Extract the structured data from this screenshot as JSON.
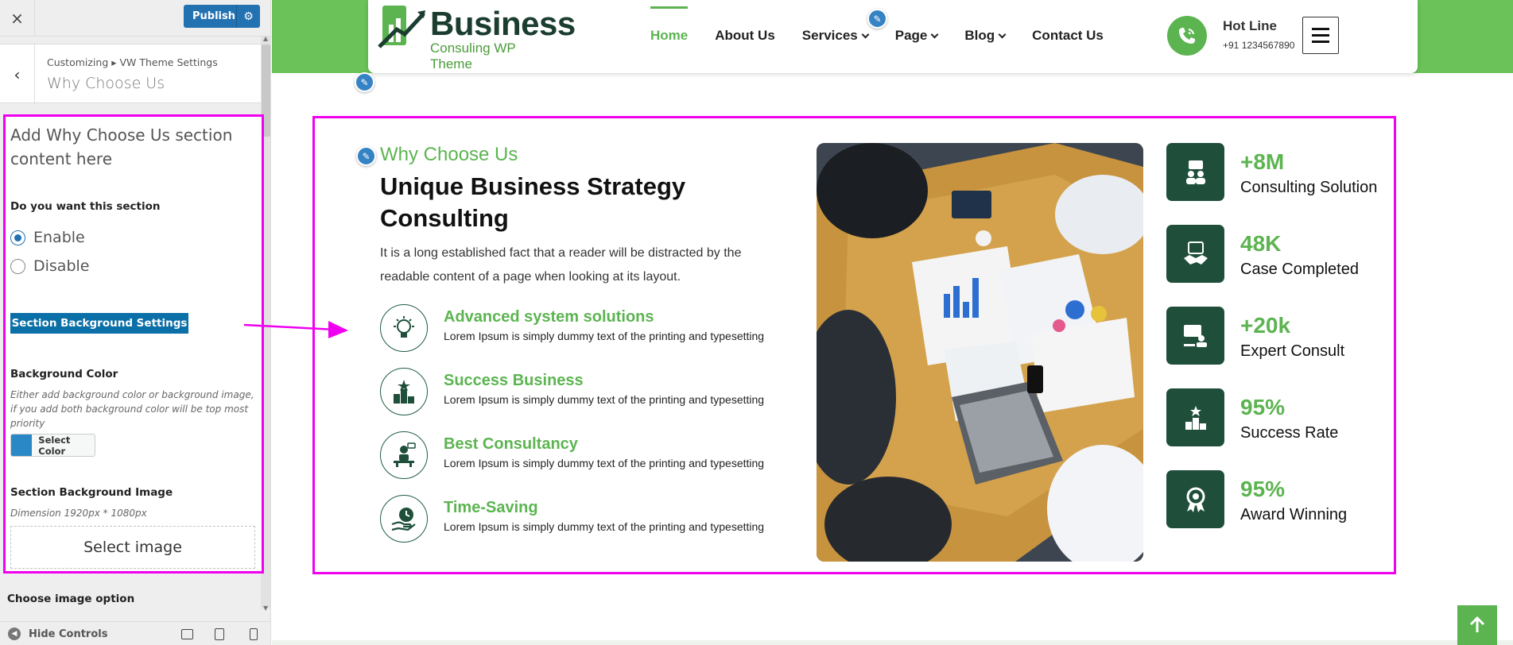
{
  "customizer": {
    "close_glyph": "×",
    "publish_label": "Publish",
    "breadcrumb": "Customizing ▸ VW Theme Settings",
    "section_title": "Why Choose Us",
    "panel": {
      "intro": "Add Why Choose Us section content here",
      "question": "Do you want this section",
      "options": [
        "Enable",
        "Disable"
      ],
      "selected": "Enable",
      "bg_settings_label": "Section Background Settings",
      "bg_color_label": "Background Color",
      "bg_color_note": "Either add background color or background image, if you add both background color will be top most priority",
      "select_color_label": "Select Color",
      "swatch_color": "#2b88c6",
      "bg_image_label": "Section Background Image",
      "dimension_note": "Dimension 1920px * 1080px",
      "select_image_label": "Select image"
    },
    "next_label": "Choose image option",
    "hide_controls_label": "Hide Controls",
    "devices": [
      "desktop-icon",
      "tablet-icon",
      "mobile-icon"
    ]
  },
  "site": {
    "accent": "#5cb451",
    "dark_green": "#1f4f3b",
    "logo": {
      "title": "Business",
      "subtitle": "Consuling WP Theme"
    },
    "nav": [
      {
        "label": "Home",
        "active": true,
        "dropdown": false
      },
      {
        "label": "About Us",
        "active": false,
        "dropdown": false
      },
      {
        "label": "Services",
        "active": false,
        "dropdown": true
      },
      {
        "label": "Page",
        "active": false,
        "dropdown": true
      },
      {
        "label": "Blog",
        "active": false,
        "dropdown": true
      },
      {
        "label": "Contact Us",
        "active": false,
        "dropdown": false
      }
    ],
    "hotline": {
      "label": "Hot Line",
      "number": "+91 1234567890"
    }
  },
  "why": {
    "kicker": "Why Choose Us",
    "title": "Unique Business Strategy Consulting",
    "description": "It is a long established fact that a reader will be distracted by the readable content of a page when looking at its layout.",
    "features": [
      {
        "title": "Advanced system solutions",
        "text": "Lorem Ipsum is simply dummy text of the printing and typesetting",
        "icon": "bulb-gear-icon"
      },
      {
        "title": "Success Business",
        "text": "Lorem Ipsum is simply dummy text of the printing and typesetting",
        "icon": "podium-star-icon"
      },
      {
        "title": "Best Consultancy",
        "text": "Lorem Ipsum is simply dummy text of the printing and typesetting",
        "icon": "consultant-desk-icon"
      },
      {
        "title": "Time-Saving",
        "text": "Lorem Ipsum is simply dummy text of the printing and typesetting",
        "icon": "hand-clock-icon"
      }
    ],
    "stats": [
      {
        "value": "+8M",
        "label": "Consulting Solution",
        "icon": "team-chat-icon"
      },
      {
        "value": "48K",
        "label": "Case Completed",
        "icon": "handshake-icon"
      },
      {
        "value": "+20k",
        "label": "Expert Consult",
        "icon": "monitor-user-icon"
      },
      {
        "value": "95%",
        "label": "Success Rate",
        "icon": "podium-icon"
      },
      {
        "value": "95%",
        "label": "Award Winning",
        "icon": "award-badge-icon"
      }
    ]
  }
}
